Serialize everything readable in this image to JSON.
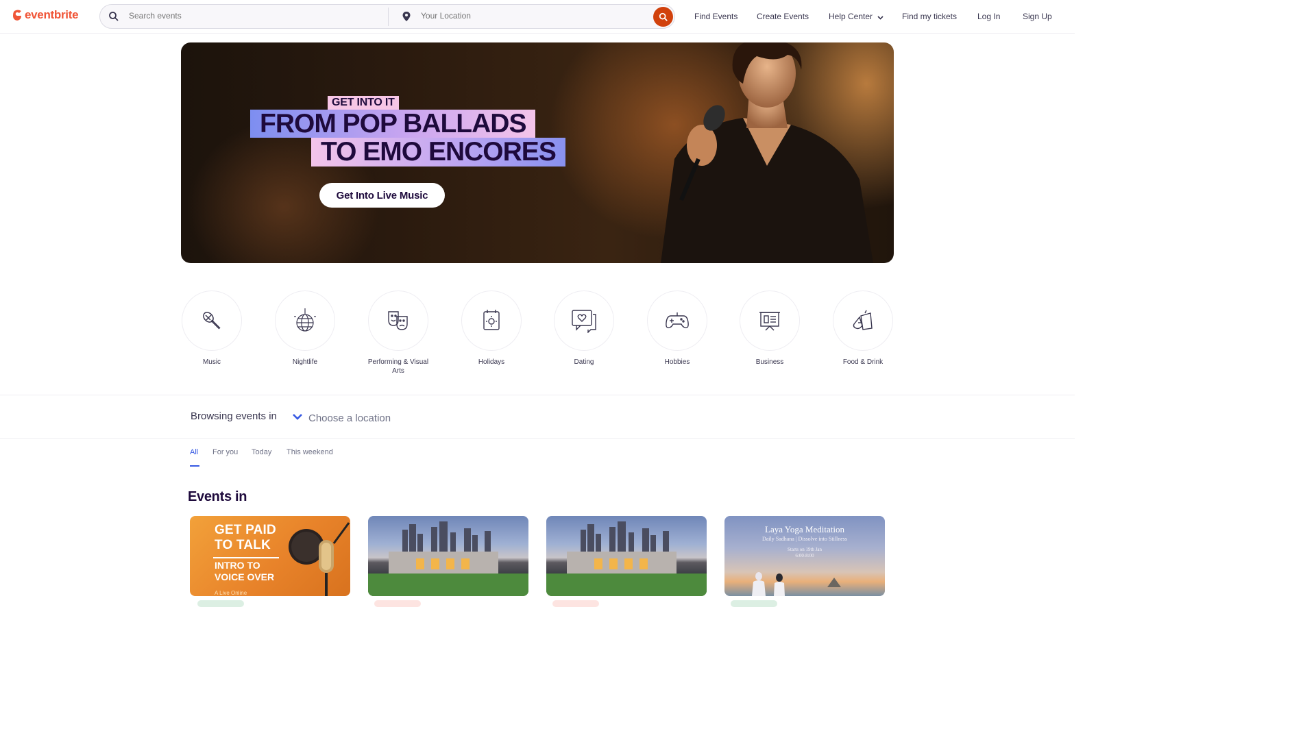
{
  "header": {
    "logo": "eventbrite",
    "search_placeholder": "Search events",
    "location_placeholder": "Your Location",
    "nav": {
      "find_events": "Find Events",
      "create_events": "Create Events",
      "help_center": "Help Center",
      "find_tickets": "Find my tickets",
      "log_in": "Log In",
      "sign_up": "Sign Up"
    }
  },
  "hero": {
    "kicker": "GET INTO IT",
    "line1": "FROM POP BALLADS",
    "line2": "TO EMO ENCORES",
    "cta": "Get Into Live Music"
  },
  "categories": [
    {
      "label": "Music",
      "icon": "microphone-icon"
    },
    {
      "label": "Nightlife",
      "icon": "disco-ball-icon"
    },
    {
      "label": "Performing & Visual Arts",
      "icon": "theater-masks-icon"
    },
    {
      "label": "Holidays",
      "icon": "calendar-icon"
    },
    {
      "label": "Dating",
      "icon": "chat-heart-icon"
    },
    {
      "label": "Hobbies",
      "icon": "game-controller-icon"
    },
    {
      "label": "Business",
      "icon": "presentation-icon"
    },
    {
      "label": "Food & Drink",
      "icon": "drinks-icon"
    }
  ],
  "browse": {
    "label": "Browsing events in",
    "location": "Choose a location"
  },
  "tabs": [
    {
      "label": "All",
      "active": true
    },
    {
      "label": "For you",
      "active": false
    },
    {
      "label": "Today",
      "active": false
    },
    {
      "label": "This weekend",
      "active": false
    }
  ],
  "events_heading": "Events in",
  "cards": [
    {
      "title_line1": "GET PAID",
      "title_line2": "TO TALK",
      "sub_line1": "INTRO TO",
      "sub_line2": "VOICE OVER",
      "footer": "A Live Online"
    },
    {
      "image": "city-skyline"
    },
    {
      "image": "city-skyline"
    },
    {
      "title": "Laya Yoga Meditation",
      "subtitle": "Daily Sadhana | Dissolve into Stillness",
      "starts": "Starts on 19th Jan",
      "time": "6:00-8:00"
    }
  ],
  "colors": {
    "brand": "#f05537",
    "search_button": "#d1410c",
    "active_tab": "#3659e3",
    "text_dark": "#1e0a3c"
  }
}
